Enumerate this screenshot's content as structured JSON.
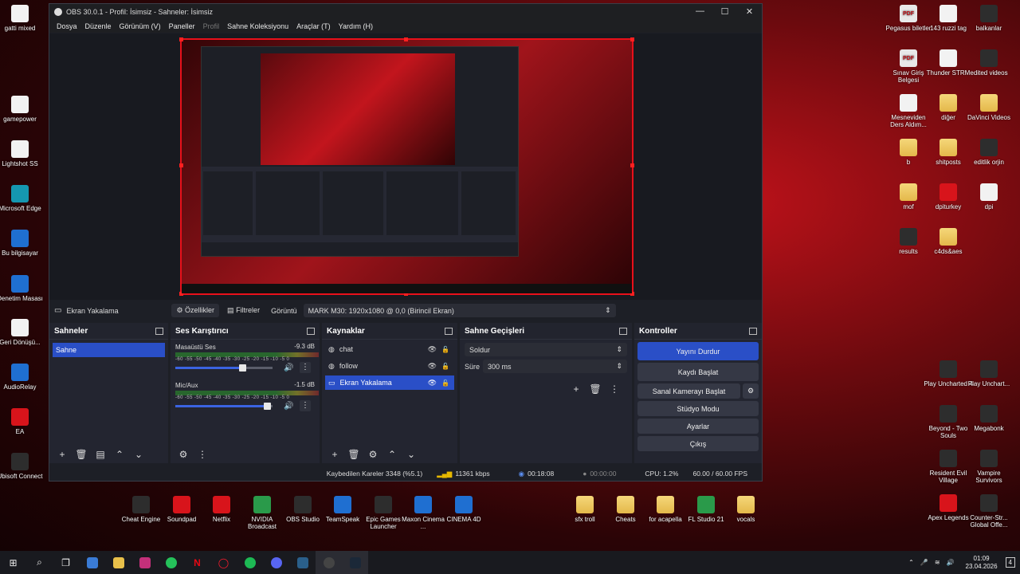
{
  "desktop_left": [
    {
      "name": "gatti mixed",
      "icon": "document-icon",
      "kind": "doc"
    },
    {
      "name": "gamepower",
      "icon": "document-icon",
      "kind": "doc"
    },
    {
      "name": "Lightshot SS",
      "icon": "document-icon",
      "kind": "doc"
    },
    {
      "name": "Microsoft Edge",
      "icon": "edge-icon",
      "kind": "teal"
    },
    {
      "name": "Bu bilgisayar",
      "icon": "computer-icon",
      "kind": "blue"
    },
    {
      "name": "Denetim Masası",
      "icon": "control-panel-icon",
      "kind": "blue"
    },
    {
      "name": "Geri Dönüşü...",
      "icon": "recycle-bin-icon",
      "kind": "doc"
    },
    {
      "name": "AudioRelay",
      "icon": "audiorelay-icon",
      "kind": "blue"
    },
    {
      "name": "EA",
      "icon": "ea-icon",
      "kind": "red"
    },
    {
      "name": "Ubisoft Connect",
      "icon": "ubisoft-icon",
      "kind": "app"
    }
  ],
  "desktop_right": [
    {
      "name": "Pegasus biletler",
      "icon": "pdf-icon",
      "kind": "pdf"
    },
    {
      "name": "143 ruzzi tag",
      "icon": "document-icon",
      "kind": "doc"
    },
    {
      "name": "balkanlar",
      "icon": "document-icon",
      "kind": "app"
    },
    {
      "name": "Sınav Giriş Belgesi",
      "icon": "pdf-icon",
      "kind": "pdf"
    },
    {
      "name": "Thunder STRM",
      "icon": "document-icon",
      "kind": "doc"
    },
    {
      "name": "edited videos",
      "icon": "document-icon",
      "kind": "app"
    },
    {
      "name": "Mesneviden Ders Aldım...",
      "icon": "document-icon",
      "kind": "doc"
    },
    {
      "name": "diğer",
      "icon": "folder-icon",
      "kind": "folder"
    },
    {
      "name": "DaVinci Videos",
      "icon": "folder-icon",
      "kind": "folder"
    },
    {
      "name": "b",
      "icon": "folder-icon",
      "kind": "folder"
    },
    {
      "name": "shitposts",
      "icon": "folder-icon",
      "kind": "folder"
    },
    {
      "name": "editlik orjin",
      "icon": "document-icon",
      "kind": "app"
    },
    {
      "name": "mof",
      "icon": "folder-icon",
      "kind": "folder"
    },
    {
      "name": "dpiturkey",
      "icon": "winrar-icon",
      "kind": "red"
    },
    {
      "name": "dpi",
      "icon": "document-icon",
      "kind": "doc"
    },
    {
      "name": "results",
      "icon": "document-icon",
      "kind": "app"
    },
    {
      "name": "c4ds&aes",
      "icon": "folder-icon",
      "kind": "folder"
    },
    {
      "name": "Play Uncharted 4",
      "icon": "uncharted-icon",
      "kind": "app"
    },
    {
      "name": "Play Unchart...",
      "icon": "uncharted-icon",
      "kind": "app"
    },
    {
      "name": "Beyond - Two Souls",
      "icon": "beyond-icon",
      "kind": "app"
    },
    {
      "name": "Megabonk",
      "icon": "megabonk-icon",
      "kind": "app"
    },
    {
      "name": "Resident Evil Village",
      "icon": "re-village-icon",
      "kind": "app"
    },
    {
      "name": "Vampire Survivors",
      "icon": "vampire-icon",
      "kind": "app"
    },
    {
      "name": "Apex Legends",
      "icon": "apex-icon",
      "kind": "red"
    },
    {
      "name": "Counter-Str... Global Offe...",
      "icon": "csgo-icon",
      "kind": "app"
    }
  ],
  "desktop_bottom": [
    {
      "name": "Cheat Engine",
      "icon": "cheat-engine-icon",
      "kind": "app"
    },
    {
      "name": "Soundpad",
      "icon": "soundpad-icon",
      "kind": "red"
    },
    {
      "name": "Netflix",
      "icon": "netflix-icon",
      "kind": "red"
    },
    {
      "name": "NVIDIA Broadcast",
      "icon": "nvidia-icon",
      "kind": "green"
    },
    {
      "name": "OBS Studio",
      "icon": "obs-icon",
      "kind": "app"
    },
    {
      "name": "TeamSpeak",
      "icon": "teamspeak-icon",
      "kind": "blue"
    },
    {
      "name": "Epic Games Launcher",
      "icon": "epic-icon",
      "kind": "app"
    },
    {
      "name": "Maxon Cinema ...",
      "icon": "maxon-icon",
      "kind": "blue"
    },
    {
      "name": "CINEMA 4D",
      "icon": "cinema4d-icon",
      "kind": "blue"
    },
    {
      "name": "sfx troll",
      "icon": "folder-icon",
      "kind": "folder"
    },
    {
      "name": "Cheats",
      "icon": "folder-icon",
      "kind": "folder"
    },
    {
      "name": "for acapella",
      "icon": "folder-icon",
      "kind": "folder"
    },
    {
      "name": "FL Studio 21",
      "icon": "flstudio-icon",
      "kind": "green"
    },
    {
      "name": "vocals",
      "icon": "folder-icon",
      "kind": "folder"
    }
  ],
  "obs": {
    "title": "OBS 30.0.1 - Profil: İsimsiz - Sahneler: İsimsiz",
    "menu": [
      "Dosya",
      "Düzenle",
      "Görünüm (V)",
      "Paneller",
      "Profil",
      "Sahne Koleksiyonu",
      "Araçlar (T)",
      "Yardım (H)"
    ],
    "source_bar": {
      "source_name": "Ekran Yakalama",
      "properties": "Özellikler",
      "filters": "Filtreler",
      "display_label": "Görüntü",
      "display_value": "MARK M30: 1920x1080 @ 0,0 (Birincil Ekran)"
    },
    "scenes": {
      "title": "Sahneler",
      "items": [
        "Sahne"
      ]
    },
    "mixer": {
      "title": "Ses Karıştırıcı",
      "ticks": "-60 -55 -50 -45 -40 -35 -30 -25 -20 -15 -10 -5 0",
      "channels": [
        {
          "name": "Masaüstü Ses",
          "db": "-9.3 dB",
          "level": 0.7
        },
        {
          "name": "Mic/Aux",
          "db": "-1.5 dB",
          "level": 0.95
        }
      ]
    },
    "sources": {
      "title": "Kaynaklar",
      "items": [
        {
          "name": "chat",
          "selected": false
        },
        {
          "name": "follow",
          "selected": false
        },
        {
          "name": "Ekran Yakalama",
          "selected": true
        }
      ]
    },
    "transitions": {
      "title": "Sahne Geçişleri",
      "type": "Soldur",
      "duration_label": "Süre",
      "duration_value": "300 ms"
    },
    "controls": {
      "title": "Kontroller",
      "buttons": [
        "Yayını Durdur",
        "Kaydı Başlat",
        "Sanal Kamerayı Başlat",
        "Stüdyo Modu",
        "Ayarlar",
        "Çıkış"
      ]
    },
    "status": {
      "dropped": "Kaybedilen Kareler 3348 (%5.1)",
      "bitrate": "11361 kbps",
      "stream_time": "00:18:08",
      "rec_time": "00:00:00",
      "cpu": "CPU: 1.2%",
      "fps": "60.00 / 60.00 FPS"
    }
  },
  "taskbar": {
    "icons": [
      "start-icon",
      "search-icon",
      "task-view-icon",
      "store-icon",
      "explorer-icon",
      "instagram-icon",
      "whatsapp-icon",
      "netflix-icon",
      "opera-icon",
      "spotify-icon",
      "discord-icon",
      "steam-tools-icon",
      "obs-icon",
      "steam-icon"
    ],
    "time": "01:09",
    "date": "23.04.2026",
    "notifications": "4"
  }
}
